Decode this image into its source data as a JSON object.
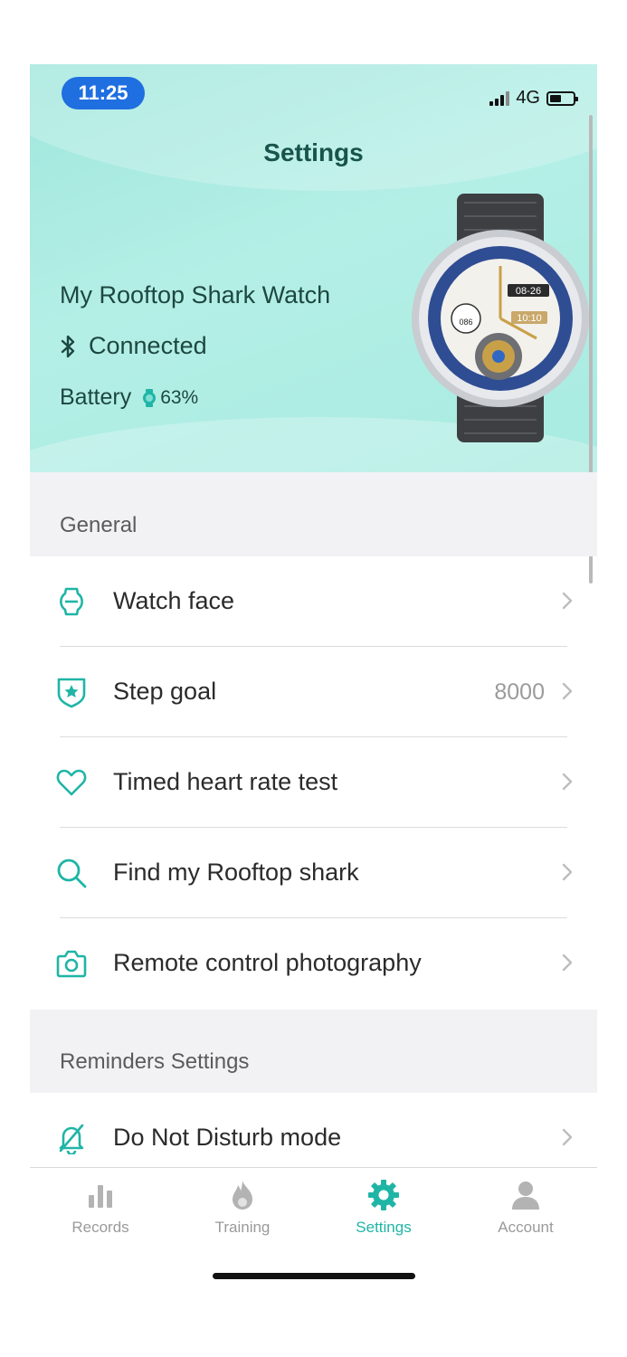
{
  "status_bar": {
    "time": "11:25",
    "network": "4G"
  },
  "header": {
    "title": "Settings",
    "device_name": "My Rooftop Shark Watch",
    "connection": "Connected",
    "battery_label": "Battery",
    "battery_value": "63%",
    "watch_face_date": "08-26",
    "watch_face_time": "10:10",
    "watch_face_hr": "086"
  },
  "sections": {
    "general": {
      "title": "General",
      "items": [
        {
          "label": "Watch face",
          "value": ""
        },
        {
          "label": "Step goal",
          "value": "8000"
        },
        {
          "label": "Timed heart rate test",
          "value": ""
        },
        {
          "label": "Find my Rooftop shark",
          "value": ""
        },
        {
          "label": "Remote control photography",
          "value": ""
        }
      ]
    },
    "reminders": {
      "title": "Reminders Settings",
      "items": [
        {
          "label": "Do Not Disturb mode",
          "value": ""
        }
      ]
    }
  },
  "tabs": [
    {
      "label": "Records",
      "icon": "bar-chart-icon"
    },
    {
      "label": "Training",
      "icon": "flame-icon"
    },
    {
      "label": "Settings",
      "icon": "gear-icon",
      "active": true
    },
    {
      "label": "Account",
      "icon": "person-icon"
    }
  ],
  "colors": {
    "accent": "#1fb5a6",
    "header_bg": "#a8ebe1",
    "time_pill": "#1f6fe0"
  }
}
